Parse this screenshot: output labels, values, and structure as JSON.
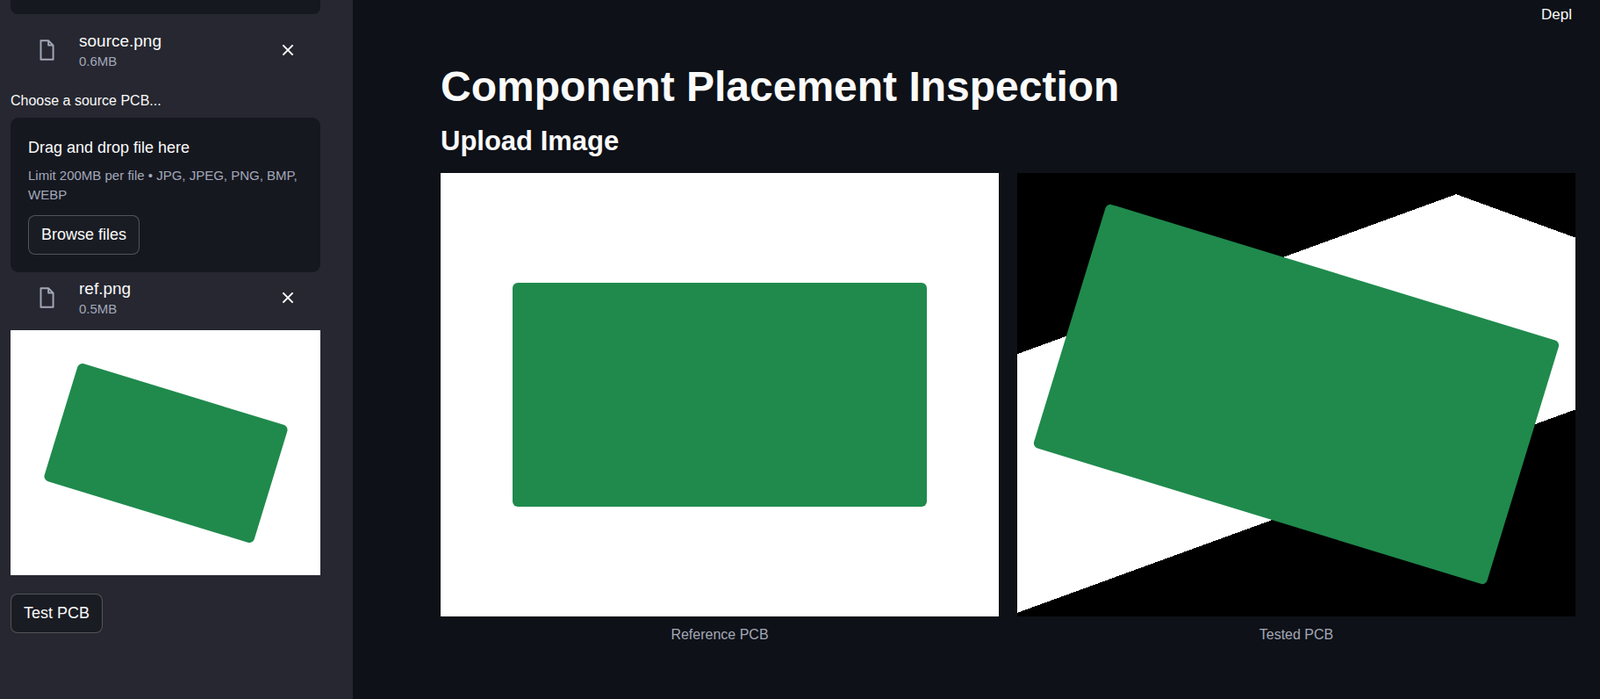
{
  "header": {
    "deploy": "Depl"
  },
  "sidebar": {
    "files_top": [
      {
        "name": "source.png",
        "size": "0.6MB"
      }
    ],
    "uploader": {
      "label": "Choose a source PCB...",
      "title": "Drag and drop file here",
      "limit": "Limit 200MB per file • JPG, JPEG, PNG, BMP, WEBP",
      "button": "Browse files"
    },
    "files_bottom": [
      {
        "name": "ref.png",
        "size": "0.5MB"
      }
    ],
    "test_button": "Test PCB"
  },
  "main": {
    "title": "Component Placement Inspection",
    "subheading": "Upload Image",
    "images": [
      {
        "caption": "Reference PCB",
        "kind": "reference"
      },
      {
        "caption": "Tested PCB",
        "kind": "tested"
      }
    ]
  }
}
